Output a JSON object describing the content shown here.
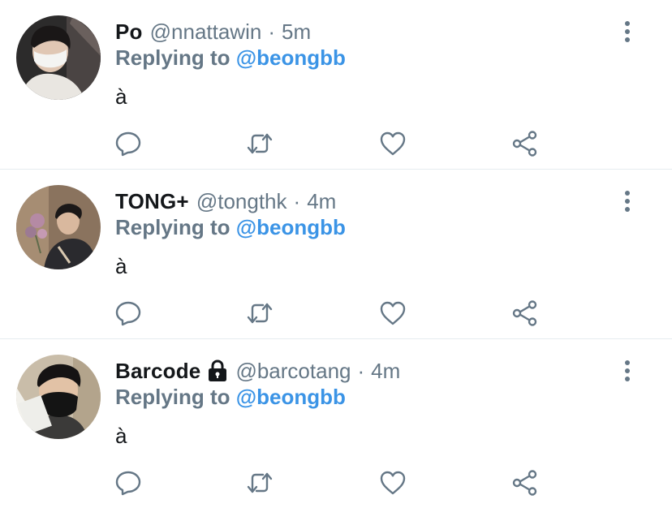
{
  "tweets": [
    {
      "name": "Po",
      "handle": "@nnattawin",
      "separator": "·",
      "time": "5m",
      "reply_prefix": "Replying to",
      "reply_target": "@beongbb",
      "text": "à",
      "locked": false,
      "avatar_icon": "profile-photo"
    },
    {
      "name": "TONG+",
      "handle": "@tongthk",
      "separator": "·",
      "time": "4m",
      "reply_prefix": "Replying to",
      "reply_target": "@beongbb",
      "text": "à",
      "locked": false,
      "avatar_icon": "profile-photo"
    },
    {
      "name": "Barcode",
      "handle": "@barcotang",
      "separator": "·",
      "time": "4m",
      "reply_prefix": "Replying to",
      "reply_target": "@beongbb",
      "text": "à",
      "locked": true,
      "avatar_icon": "profile-photo"
    }
  ],
  "actions": [
    "reply-icon",
    "retweet-icon",
    "like-icon",
    "share-icon"
  ],
  "colors": {
    "name": "#14171a",
    "secondary_text": "#657786",
    "mention": "#3b94e6",
    "icon": "#657786",
    "divider": "#e6ecf0"
  }
}
